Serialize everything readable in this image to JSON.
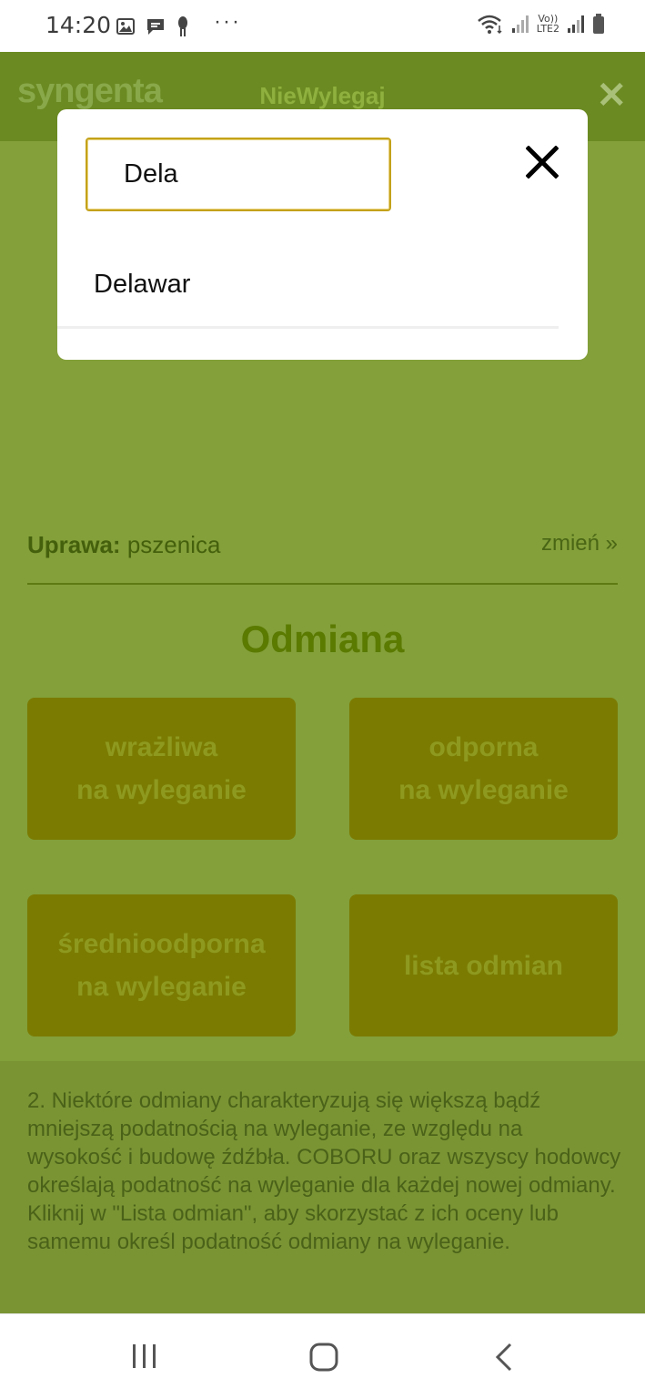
{
  "status_bar": {
    "time": "14:20",
    "dots": "···",
    "lte_top": "Vo))",
    "lte_bottom": "LTE2",
    "icons": [
      "image-icon",
      "message-icon",
      "notification-icon",
      "wifi-icon",
      "signal-icon",
      "battery-icon"
    ]
  },
  "header": {
    "logo": "syngenta",
    "title": "NieWylegaj",
    "close": "✕"
  },
  "crop": {
    "label": "Uprawa:",
    "value": "pszenica",
    "change": "zmień »"
  },
  "section_title": "Odmiana",
  "options": [
    {
      "line1": "wrażliwa",
      "line2": "na wyleganie"
    },
    {
      "line1": "odporna",
      "line2": "na wyleganie"
    },
    {
      "line1": "średnioodporna",
      "line2": "na wyleganie"
    },
    {
      "line1": "lista odmian",
      "line2": ""
    }
  ],
  "info_text": "2. Niektóre odmiany charakteryzują się większą bądź mniejszą podatnością na wyleganie, ze względu na wysokość i budowę źdźbła. COBORU oraz wszyscy hodowcy określają podatność na wyleganie dla każdej nowej odmiany. Kliknij w \"Lista odmian\", aby skorzystać z ich oceny lub samemu określ podatność odmiany na wyleganie.",
  "modal": {
    "search_value": "Dela",
    "results": [
      "Delawar"
    ]
  },
  "colors": {
    "app_bg": "#83a03a",
    "header_bg": "#6b8a22",
    "option_bg": "#7b7b02",
    "search_border": "#c4a21a"
  }
}
